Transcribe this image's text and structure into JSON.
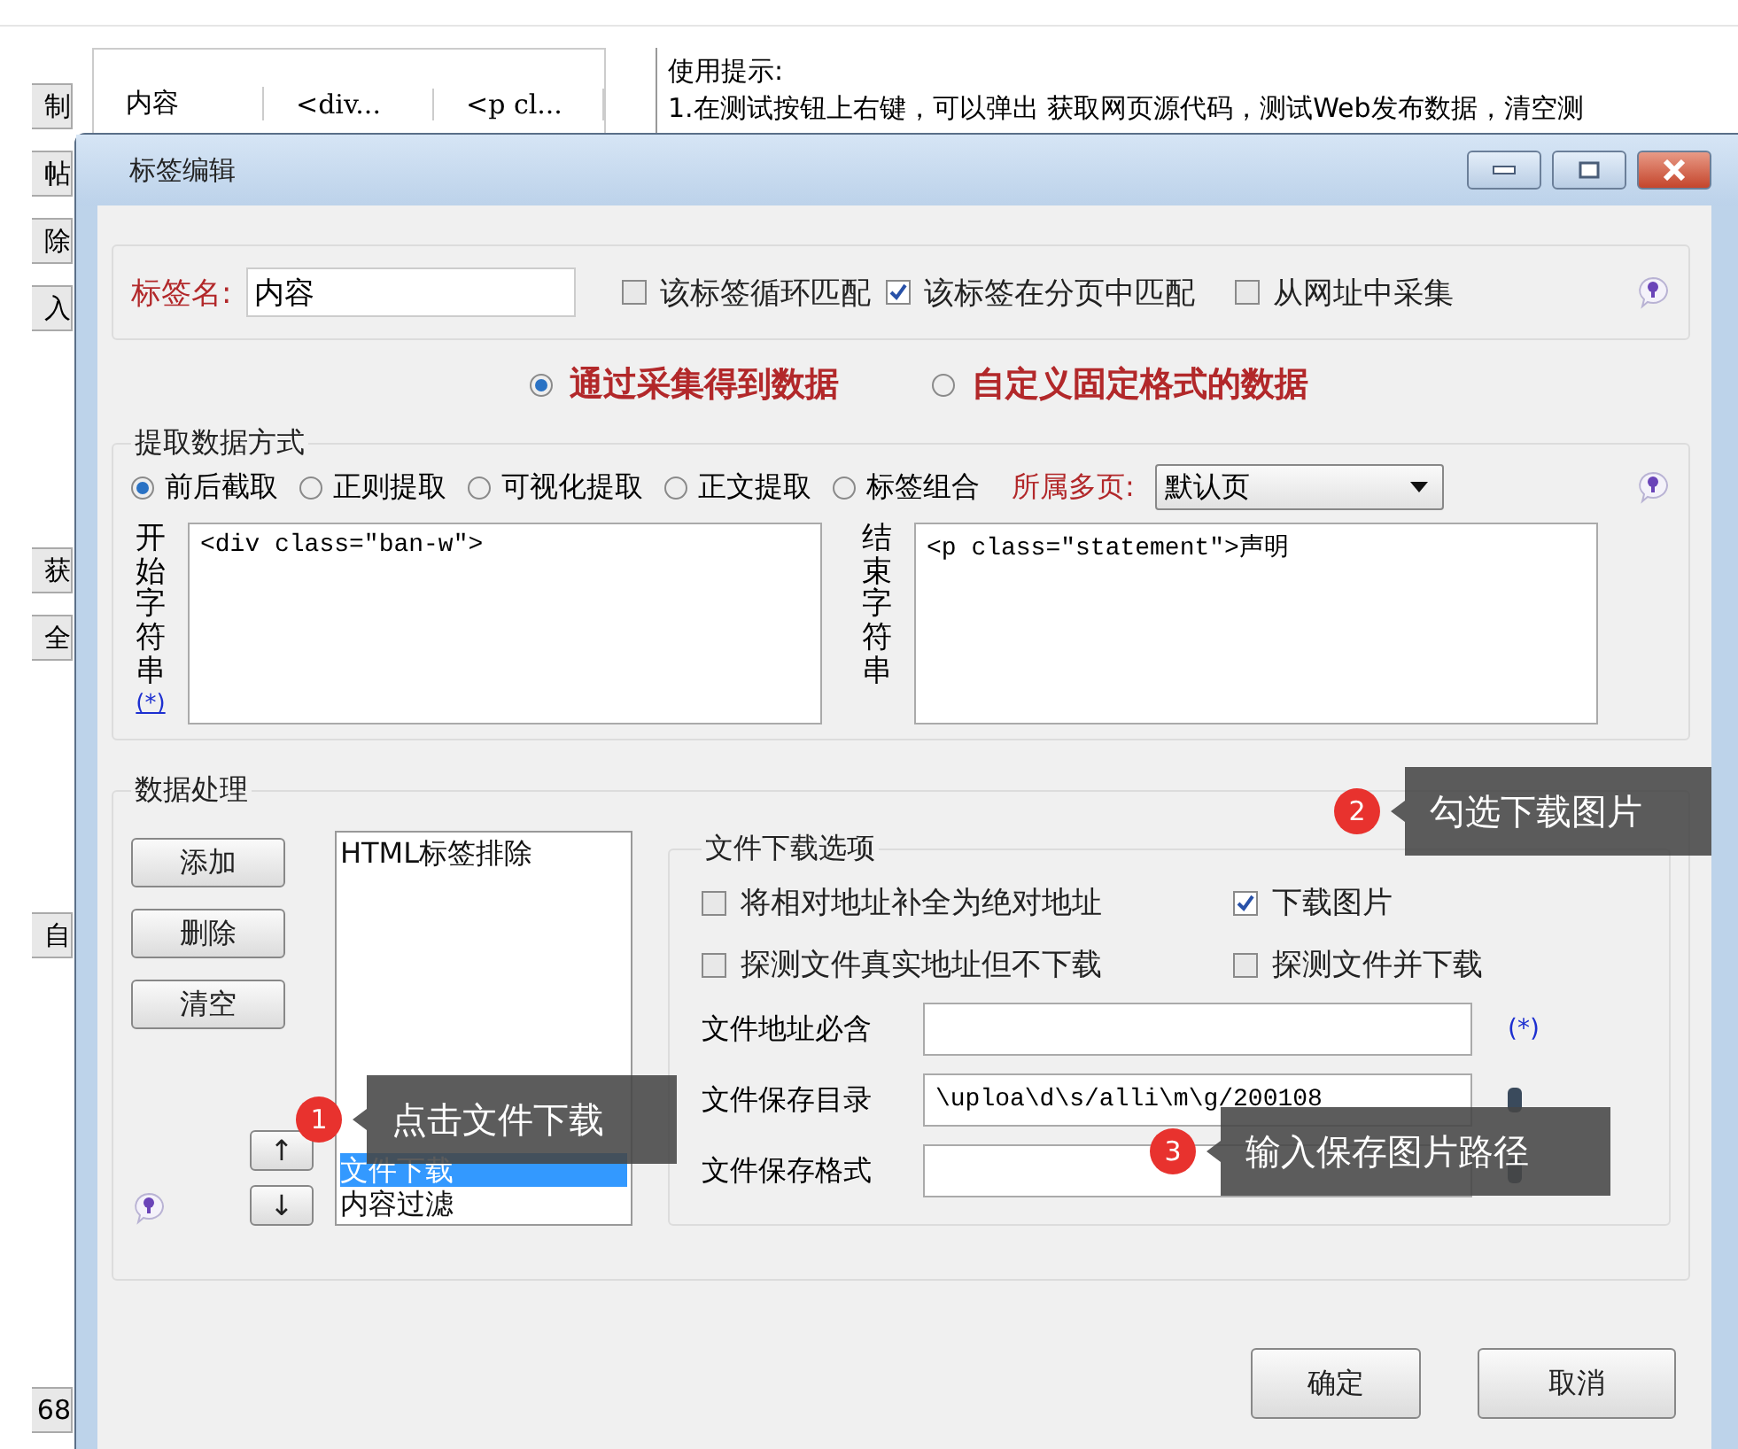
{
  "background_app": {
    "side_fragments": [
      "制",
      "帖",
      "除",
      "入",
      "获",
      "全",
      "自",
      "68"
    ],
    "table_row": [
      "内容",
      "<div...",
      "<p cl..."
    ],
    "hint_title": "使用提示:",
    "hint_line": "1.在测试按钮上右键，可以弹出 获取网页源代码，测试Web发布数据，清空测"
  },
  "dialog": {
    "title": "标签编辑",
    "tag_name": {
      "label": "标签名:",
      "value": "内容"
    },
    "options": [
      {
        "label": "该标签循环匹配",
        "checked": false
      },
      {
        "label": "该标签在分页中匹配",
        "checked": true
      },
      {
        "label": "从网址中采集",
        "checked": false
      }
    ],
    "source_modes": [
      {
        "label": "通过采集得到数据",
        "selected": true
      },
      {
        "label": "自定义固定格式的数据",
        "selected": false
      }
    ],
    "extraction": {
      "title": "提取数据方式",
      "methods": [
        {
          "label": "前后截取",
          "selected": true
        },
        {
          "label": "正则提取",
          "selected": false
        },
        {
          "label": "可视化提取",
          "selected": false
        },
        {
          "label": "正文提取",
          "selected": false
        },
        {
          "label": "标签组合",
          "selected": false
        }
      ],
      "page_label": "所属多页:",
      "page_value": "默认页",
      "start": {
        "label": "开始字符串",
        "link": "(*)",
        "value": "<div class=\"ban-w\">"
      },
      "end": {
        "label": "结束字符串",
        "value": "<p class=\"statement\">声明"
      }
    },
    "processing": {
      "title": "数据处理",
      "buttons": [
        "添加",
        "删除",
        "清空"
      ],
      "list": [
        {
          "label": "HTML标签排除",
          "selected": false
        },
        {
          "label": "文件下载",
          "selected": true
        },
        {
          "label": "内容过滤",
          "selected": false
        }
      ],
      "move_buttons": [
        "↑",
        "↓"
      ],
      "download": {
        "title": "文件下载选项",
        "options": [
          {
            "label": "将相对地址补全为绝对地址",
            "checked": false
          },
          {
            "label": "下载图片",
            "checked": true
          },
          {
            "label": "探测文件真实地址但不下载",
            "checked": false
          },
          {
            "label": "探测文件并下载",
            "checked": false
          }
        ],
        "fields": [
          {
            "label": "文件地址必含",
            "link": "(*)"
          },
          {
            "label": "文件保存目录",
            "value": "\\uploa\\d\\s/alli\\m\\g/200108",
            "icon": true
          },
          {
            "label": "文件保存格式",
            "icon": true
          }
        ]
      }
    },
    "buttons": [
      "确定",
      "取消"
    ]
  },
  "callouts": [
    {
      "number": "1",
      "text": "点击文件下载"
    },
    {
      "number": "2",
      "text": "勾选下载图片"
    },
    {
      "number": "3",
      "text": "输入保存图片路径"
    }
  ]
}
